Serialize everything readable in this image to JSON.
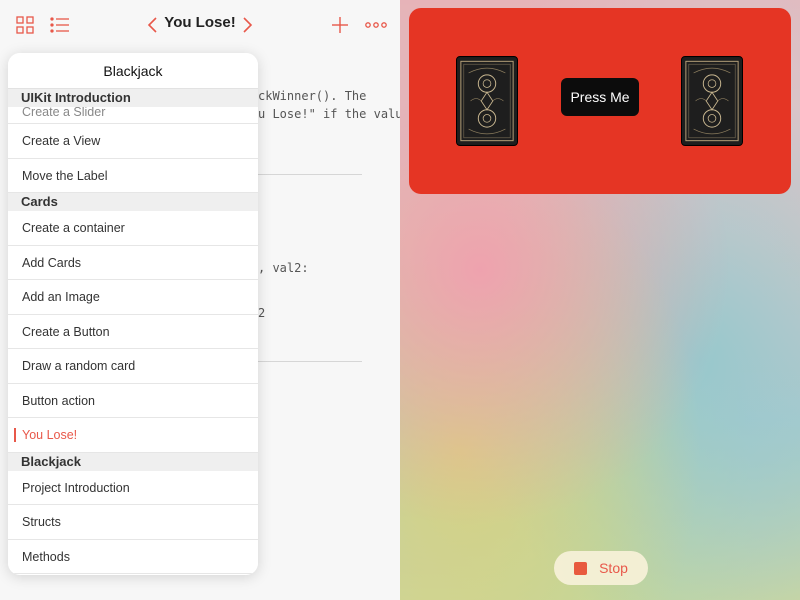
{
  "toolbar": {
    "title": "You Lose!",
    "grid_icon": "grid-icon",
    "list_icon": "list-icon",
    "back_icon": "chevron-left-icon",
    "forward_icon": "chevron-right-icon",
    "add_icon": "plus-icon",
    "more_icon": "ellipsis-icon"
  },
  "code": {
    "line1": "ckWinner(). The",
    "line2": "u Lose!\" if the value",
    "line3": ", val2:",
    "line4": "2"
  },
  "popover": {
    "title": "Blackjack",
    "sections": [
      {
        "header": "UIKit Introduction",
        "items": [
          "Create a Slider",
          "Create a View",
          "Move the Label"
        ]
      },
      {
        "header": "Cards",
        "items": [
          "Create a container",
          "Add Cards",
          "Add an Image",
          "Create a Button",
          "Draw a random card",
          "Button action",
          "You Lose!"
        ]
      },
      {
        "header": "Blackjack",
        "items": [
          "Project Introduction",
          "Structs",
          "Methods"
        ]
      }
    ],
    "selected": "You Lose!"
  },
  "live_view": {
    "button_label": "Press Me",
    "stop_label": "Stop",
    "panel_color": "#e53524",
    "accent_color": "#e8584a"
  }
}
